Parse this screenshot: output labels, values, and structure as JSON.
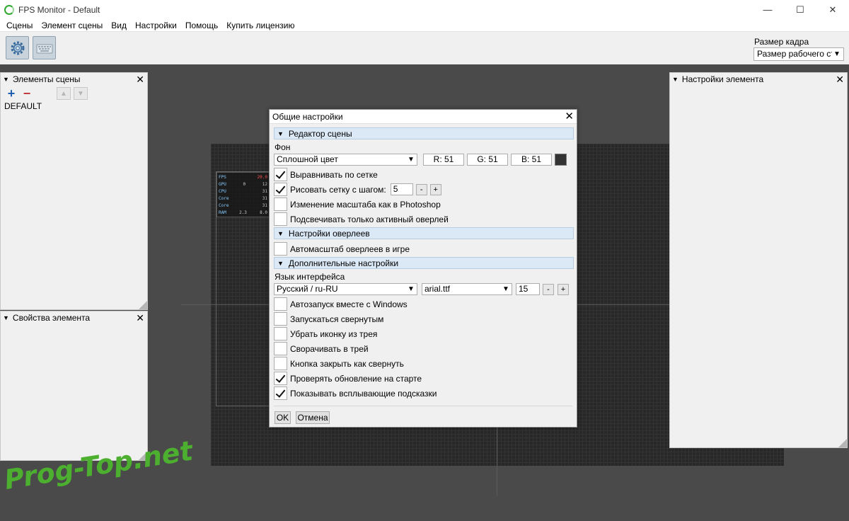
{
  "window": {
    "title": "FPS Monitor - Default",
    "controls": {
      "minimize": "—",
      "maximize": "☐",
      "close": "✕"
    }
  },
  "menu": [
    "Сцены",
    "Элемент сцены",
    "Вид",
    "Настройки",
    "Помощь",
    "Купить лицензию"
  ],
  "toolbar": {
    "frame_size_label": "Размер кадра",
    "frame_size_value": "Размер рабочего ст",
    "buttons": [
      "gear-icon",
      "keyboard-icon"
    ]
  },
  "panels": {
    "scene_elements": {
      "title": "Элементы сцены",
      "items": [
        "DEFAULT"
      ]
    },
    "element_properties": {
      "title": "Свойства элемента"
    },
    "element_settings": {
      "title": "Настройки элемента"
    }
  },
  "overlay_preview": {
    "rows": [
      {
        "key": "FPS",
        "value": "",
        "unit": "20.0"
      },
      {
        "key": "GPU",
        "value": "0",
        "unit": "12"
      },
      {
        "key": "CPU",
        "value": "",
        "unit": "31"
      },
      {
        "key": "Core",
        "value": "",
        "unit": "31"
      },
      {
        "key": "Core",
        "value": "",
        "unit": "31"
      },
      {
        "key": "RAM",
        "value": "2.3",
        "unit": "8.0"
      }
    ]
  },
  "dialog": {
    "title": "Общие настройки",
    "sections": {
      "scene_editor": "Редактор сцены",
      "overlay_settings": "Настройки оверлеев",
      "additional": "Дополнительные настройки"
    },
    "background": {
      "label": "Фон",
      "mode": "Сплошной цвет",
      "r": "R: 51",
      "g": "G: 51",
      "b": "B: 51",
      "color": "#333333"
    },
    "scene_options": [
      {
        "label": "Выравнивать по сетке",
        "checked": true
      },
      {
        "label": "Рисовать сетку с шагом:",
        "checked": true
      },
      {
        "label": "Изменение масштаба как в Photoshop",
        "checked": false
      },
      {
        "label": "Подсвечивать только активный оверлей",
        "checked": false
      }
    ],
    "grid_step": "5",
    "overlay_options": [
      {
        "label": "Автомасштаб оверлеев в игре",
        "checked": false
      }
    ],
    "language_label": "Язык интерфейса",
    "language": "Русский / ru-RU",
    "font": "arial.ttf",
    "font_size": "15",
    "minus": "-",
    "plus": "+",
    "additional_options": [
      {
        "label": "Автозапуск вместе с Windows",
        "checked": false
      },
      {
        "label": "Запускаться свернутым",
        "checked": false
      },
      {
        "label": "Убрать иконку из трея",
        "checked": false
      },
      {
        "label": "Сворачивать в трей",
        "checked": false
      },
      {
        "label": "Кнопка закрыть как свернуть",
        "checked": false
      },
      {
        "label": "Проверять обновление на старте",
        "checked": true
      },
      {
        "label": "Показывать всплывающие подсказки",
        "checked": true
      }
    ],
    "ok": "OK",
    "cancel": "Отмена"
  },
  "watermark": "Prog-Top.net"
}
